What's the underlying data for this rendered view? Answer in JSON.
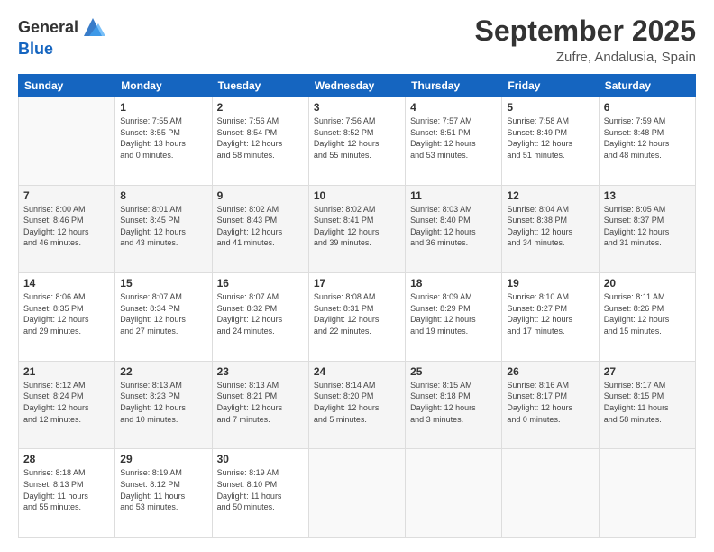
{
  "header": {
    "logo_general": "General",
    "logo_blue": "Blue",
    "title": "September 2025",
    "subtitle": "Zufre, Andalusia, Spain"
  },
  "days_of_week": [
    "Sunday",
    "Monday",
    "Tuesday",
    "Wednesday",
    "Thursday",
    "Friday",
    "Saturday"
  ],
  "weeks": [
    [
      {
        "day": "",
        "info": ""
      },
      {
        "day": "1",
        "info": "Sunrise: 7:55 AM\nSunset: 8:55 PM\nDaylight: 13 hours\nand 0 minutes."
      },
      {
        "day": "2",
        "info": "Sunrise: 7:56 AM\nSunset: 8:54 PM\nDaylight: 12 hours\nand 58 minutes."
      },
      {
        "day": "3",
        "info": "Sunrise: 7:56 AM\nSunset: 8:52 PM\nDaylight: 12 hours\nand 55 minutes."
      },
      {
        "day": "4",
        "info": "Sunrise: 7:57 AM\nSunset: 8:51 PM\nDaylight: 12 hours\nand 53 minutes."
      },
      {
        "day": "5",
        "info": "Sunrise: 7:58 AM\nSunset: 8:49 PM\nDaylight: 12 hours\nand 51 minutes."
      },
      {
        "day": "6",
        "info": "Sunrise: 7:59 AM\nSunset: 8:48 PM\nDaylight: 12 hours\nand 48 minutes."
      }
    ],
    [
      {
        "day": "7",
        "info": "Sunrise: 8:00 AM\nSunset: 8:46 PM\nDaylight: 12 hours\nand 46 minutes."
      },
      {
        "day": "8",
        "info": "Sunrise: 8:01 AM\nSunset: 8:45 PM\nDaylight: 12 hours\nand 43 minutes."
      },
      {
        "day": "9",
        "info": "Sunrise: 8:02 AM\nSunset: 8:43 PM\nDaylight: 12 hours\nand 41 minutes."
      },
      {
        "day": "10",
        "info": "Sunrise: 8:02 AM\nSunset: 8:41 PM\nDaylight: 12 hours\nand 39 minutes."
      },
      {
        "day": "11",
        "info": "Sunrise: 8:03 AM\nSunset: 8:40 PM\nDaylight: 12 hours\nand 36 minutes."
      },
      {
        "day": "12",
        "info": "Sunrise: 8:04 AM\nSunset: 8:38 PM\nDaylight: 12 hours\nand 34 minutes."
      },
      {
        "day": "13",
        "info": "Sunrise: 8:05 AM\nSunset: 8:37 PM\nDaylight: 12 hours\nand 31 minutes."
      }
    ],
    [
      {
        "day": "14",
        "info": "Sunrise: 8:06 AM\nSunset: 8:35 PM\nDaylight: 12 hours\nand 29 minutes."
      },
      {
        "day": "15",
        "info": "Sunrise: 8:07 AM\nSunset: 8:34 PM\nDaylight: 12 hours\nand 27 minutes."
      },
      {
        "day": "16",
        "info": "Sunrise: 8:07 AM\nSunset: 8:32 PM\nDaylight: 12 hours\nand 24 minutes."
      },
      {
        "day": "17",
        "info": "Sunrise: 8:08 AM\nSunset: 8:31 PM\nDaylight: 12 hours\nand 22 minutes."
      },
      {
        "day": "18",
        "info": "Sunrise: 8:09 AM\nSunset: 8:29 PM\nDaylight: 12 hours\nand 19 minutes."
      },
      {
        "day": "19",
        "info": "Sunrise: 8:10 AM\nSunset: 8:27 PM\nDaylight: 12 hours\nand 17 minutes."
      },
      {
        "day": "20",
        "info": "Sunrise: 8:11 AM\nSunset: 8:26 PM\nDaylight: 12 hours\nand 15 minutes."
      }
    ],
    [
      {
        "day": "21",
        "info": "Sunrise: 8:12 AM\nSunset: 8:24 PM\nDaylight: 12 hours\nand 12 minutes."
      },
      {
        "day": "22",
        "info": "Sunrise: 8:13 AM\nSunset: 8:23 PM\nDaylight: 12 hours\nand 10 minutes."
      },
      {
        "day": "23",
        "info": "Sunrise: 8:13 AM\nSunset: 8:21 PM\nDaylight: 12 hours\nand 7 minutes."
      },
      {
        "day": "24",
        "info": "Sunrise: 8:14 AM\nSunset: 8:20 PM\nDaylight: 12 hours\nand 5 minutes."
      },
      {
        "day": "25",
        "info": "Sunrise: 8:15 AM\nSunset: 8:18 PM\nDaylight: 12 hours\nand 3 minutes."
      },
      {
        "day": "26",
        "info": "Sunrise: 8:16 AM\nSunset: 8:17 PM\nDaylight: 12 hours\nand 0 minutes."
      },
      {
        "day": "27",
        "info": "Sunrise: 8:17 AM\nSunset: 8:15 PM\nDaylight: 11 hours\nand 58 minutes."
      }
    ],
    [
      {
        "day": "28",
        "info": "Sunrise: 8:18 AM\nSunset: 8:13 PM\nDaylight: 11 hours\nand 55 minutes."
      },
      {
        "day": "29",
        "info": "Sunrise: 8:19 AM\nSunset: 8:12 PM\nDaylight: 11 hours\nand 53 minutes."
      },
      {
        "day": "30",
        "info": "Sunrise: 8:19 AM\nSunset: 8:10 PM\nDaylight: 11 hours\nand 50 minutes."
      },
      {
        "day": "",
        "info": ""
      },
      {
        "day": "",
        "info": ""
      },
      {
        "day": "",
        "info": ""
      },
      {
        "day": "",
        "info": ""
      }
    ]
  ]
}
